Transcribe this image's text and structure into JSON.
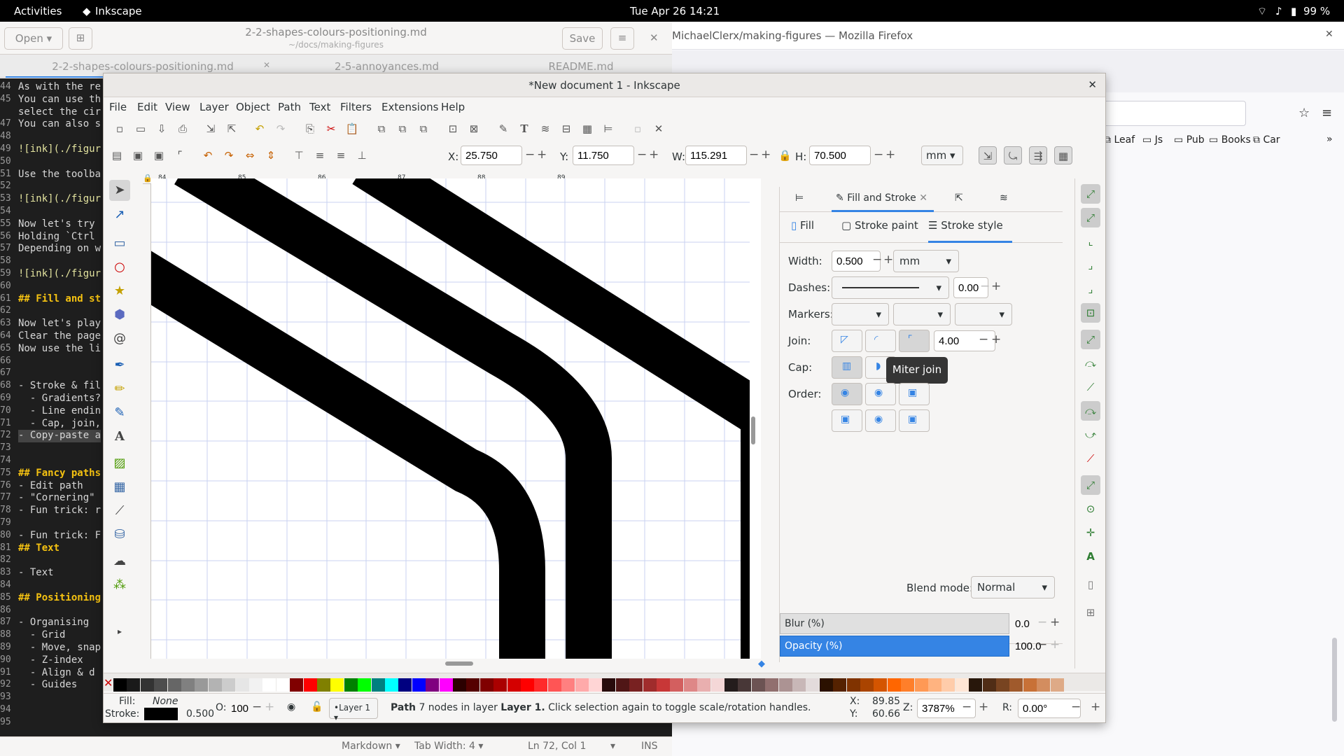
{
  "topbar": {
    "activities": "Activities",
    "app": "Inkscape",
    "clock": "Tue Apr 26  14:21",
    "battery": "99 %"
  },
  "gedit": {
    "open_label": "Open",
    "save_label": "Save",
    "title": "2-2-shapes-colours-positioning.md",
    "subtitle": "~/docs/making-figures",
    "tabs": [
      {
        "label": "2-2-shapes-colours-positioning.md"
      },
      {
        "label": "2-5-annoyances.md"
      },
      {
        "label": "README.md"
      }
    ],
    "lines": [
      {
        "n": "44",
        "t": "As with the re"
      },
      {
        "n": "45",
        "t": "You can use th"
      },
      {
        "n": "",
        "t": "select the cir"
      },
      {
        "n": "47",
        "t": "You can also s"
      },
      {
        "n": "48",
        "t": ""
      },
      {
        "n": "49",
        "t": "![ink](./figur"
      },
      {
        "n": "50",
        "t": ""
      },
      {
        "n": "51",
        "t": "Use the toolba"
      },
      {
        "n": "52",
        "t": ""
      },
      {
        "n": "53",
        "t": "![ink](./figur"
      },
      {
        "n": "54",
        "t": ""
      },
      {
        "n": "55",
        "t": "Now let's try "
      },
      {
        "n": "56",
        "t": "Holding `Ctrl"
      },
      {
        "n": "57",
        "t": "Depending on w"
      },
      {
        "n": "58",
        "t": ""
      },
      {
        "n": "59",
        "t": "![ink](./figur"
      },
      {
        "n": "60",
        "t": ""
      },
      {
        "n": "61",
        "t": "## Fill and st"
      },
      {
        "n": "62",
        "t": ""
      },
      {
        "n": "63",
        "t": "Now let's play"
      },
      {
        "n": "64",
        "t": "Clear the page"
      },
      {
        "n": "65",
        "t": "Now use the li"
      },
      {
        "n": "66",
        "t": ""
      },
      {
        "n": "67",
        "t": ""
      },
      {
        "n": "68",
        "t": "- Stroke & fil"
      },
      {
        "n": "69",
        "t": "  - Gradients?"
      },
      {
        "n": "70",
        "t": "  - Line endin"
      },
      {
        "n": "71",
        "t": "  - Cap, join,"
      },
      {
        "n": "72",
        "t": "- Copy-paste a"
      },
      {
        "n": "73",
        "t": ""
      },
      {
        "n": "74",
        "t": ""
      },
      {
        "n": "75",
        "t": "## Fancy paths"
      },
      {
        "n": "76",
        "t": "- Edit path"
      },
      {
        "n": "77",
        "t": "- \"Cornering\""
      },
      {
        "n": "78",
        "t": "- Fun trick: r"
      },
      {
        "n": "79",
        "t": ""
      },
      {
        "n": "80",
        "t": "- Fun trick: F"
      },
      {
        "n": "81",
        "t": "## Text"
      },
      {
        "n": "82",
        "t": ""
      },
      {
        "n": "83",
        "t": "- Text"
      },
      {
        "n": "84",
        "t": ""
      },
      {
        "n": "85",
        "t": "## Positioning"
      },
      {
        "n": "86",
        "t": ""
      },
      {
        "n": "87",
        "t": "- Organising"
      },
      {
        "n": "88",
        "t": "  - Grid"
      },
      {
        "n": "89",
        "t": "  - Move, snap"
      },
      {
        "n": "90",
        "t": "  - Z-index"
      },
      {
        "n": "91",
        "t": "  - Align & d"
      },
      {
        "n": "92",
        "t": "  - Guides"
      },
      {
        "n": "93",
        "t": ""
      },
      {
        "n": "94",
        "t": ""
      },
      {
        "n": "95",
        "t": ""
      }
    ],
    "status": {
      "lang": "Markdown",
      "tab": "Tab Width: 4",
      "pos": "Ln 72, Col 1",
      "mode": "INS"
    }
  },
  "firefox": {
    "title": "MichaelClerx/making-figures — Mozilla Firefox",
    "bookmarks": [
      "Leaf",
      "Js",
      "Pub",
      "Books",
      "Car"
    ]
  },
  "inkscape": {
    "title": "*New document 1 - Inkscape",
    "menu": [
      "File",
      "Edit",
      "View",
      "Layer",
      "Object",
      "Path",
      "Text",
      "Filters",
      "Extensions",
      "Help"
    ],
    "x_label": "X:",
    "x": "25.750",
    "y_label": "Y:",
    "y": "11.750",
    "w_label": "W:",
    "w": "115.291",
    "h_label": "H:",
    "h": "70.500",
    "unit": "mm",
    "ruler_ticks": [
      "84",
      "85",
      "86",
      "87",
      "88",
      "89"
    ],
    "dock": {
      "tab_active": "Fill and Stroke",
      "subtabs": [
        "Fill",
        "Stroke paint",
        "Stroke style"
      ],
      "width_label": "Width:",
      "width": "0.500",
      "width_unit": "mm",
      "dashes_label": "Dashes:",
      "dash_offset": "0.00",
      "markers_label": "Markers:",
      "join_label": "Join:",
      "miter": "4.00",
      "cap_label": "Cap:",
      "order_label": "Order:",
      "tooltip": "Miter join",
      "blend_label": "Blend mode:",
      "blend": "Normal",
      "blur_label": "Blur (%)",
      "blur": "0.0",
      "opacity_label": "Opacity (%)",
      "opacity": "100.0"
    },
    "status": {
      "fill_label": "Fill:",
      "fill": "None",
      "stroke_label": "Stroke:",
      "stroke_width": "0.500",
      "o_label": "O:",
      "opacity": "100",
      "layer": "•Layer 1",
      "message_b": "Path",
      "message": " 7 nodes in layer ",
      "message_layer": "Layer 1.",
      "message_end": " Click selection again to toggle scale/rotation handles.",
      "x_label": "X:",
      "x": "89.85",
      "y_label": "Y:",
      "y": "60.66",
      "z_label": "Z:",
      "zoom": "3787%",
      "r_label": "R:",
      "rotation": "0.00°"
    }
  },
  "colors": {
    "accent": "#3584e4",
    "selection": "#3584e4",
    "tooltip_bg": "#353535"
  }
}
